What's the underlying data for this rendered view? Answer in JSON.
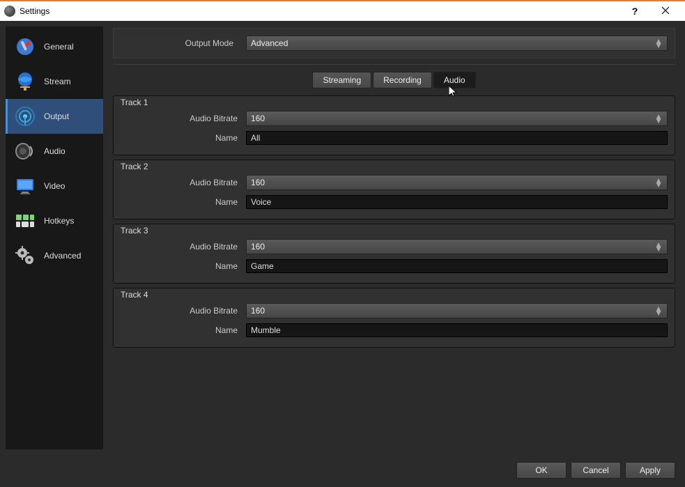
{
  "window": {
    "title": "Settings"
  },
  "sidebar": {
    "items": [
      {
        "label": "General"
      },
      {
        "label": "Stream"
      },
      {
        "label": "Output"
      },
      {
        "label": "Audio"
      },
      {
        "label": "Video"
      },
      {
        "label": "Hotkeys"
      },
      {
        "label": "Advanced"
      }
    ],
    "selected": 2
  },
  "output": {
    "mode_label": "Output Mode",
    "mode_value": "Advanced",
    "tabs": [
      {
        "label": "Streaming"
      },
      {
        "label": "Recording"
      },
      {
        "label": "Audio"
      }
    ],
    "active_tab": 2,
    "field_labels": {
      "bitrate": "Audio Bitrate",
      "name": "Name"
    },
    "tracks": [
      {
        "title": "Track 1",
        "bitrate": "160",
        "name": "All"
      },
      {
        "title": "Track 2",
        "bitrate": "160",
        "name": "Voice"
      },
      {
        "title": "Track 3",
        "bitrate": "160",
        "name": "Game"
      },
      {
        "title": "Track 4",
        "bitrate": "160",
        "name": "Mumble"
      }
    ]
  },
  "footer": {
    "ok": "OK",
    "cancel": "Cancel",
    "apply": "Apply"
  }
}
